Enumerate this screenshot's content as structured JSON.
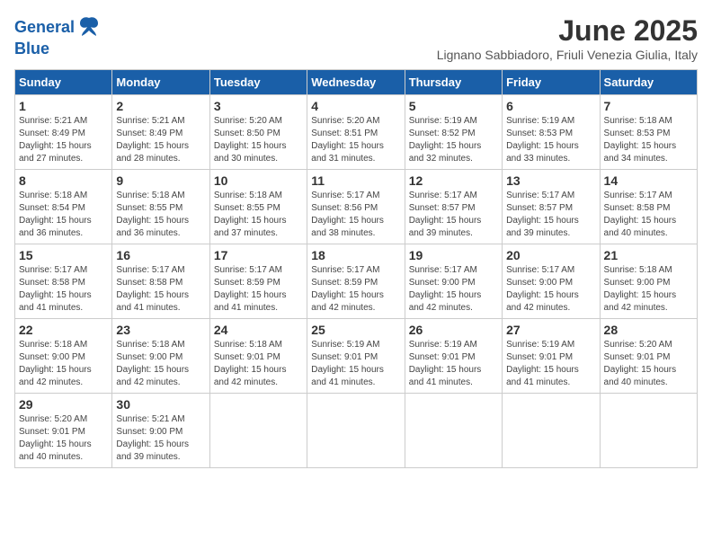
{
  "logo": {
    "line1": "General",
    "line2": "Blue"
  },
  "title": "June 2025",
  "location": "Lignano Sabbiadoro, Friuli Venezia Giulia, Italy",
  "weekdays": [
    "Sunday",
    "Monday",
    "Tuesday",
    "Wednesday",
    "Thursday",
    "Friday",
    "Saturday"
  ],
  "weeks": [
    [
      {
        "day": "1",
        "info": "Sunrise: 5:21 AM\nSunset: 8:49 PM\nDaylight: 15 hours\nand 27 minutes."
      },
      {
        "day": "2",
        "info": "Sunrise: 5:21 AM\nSunset: 8:49 PM\nDaylight: 15 hours\nand 28 minutes."
      },
      {
        "day": "3",
        "info": "Sunrise: 5:20 AM\nSunset: 8:50 PM\nDaylight: 15 hours\nand 30 minutes."
      },
      {
        "day": "4",
        "info": "Sunrise: 5:20 AM\nSunset: 8:51 PM\nDaylight: 15 hours\nand 31 minutes."
      },
      {
        "day": "5",
        "info": "Sunrise: 5:19 AM\nSunset: 8:52 PM\nDaylight: 15 hours\nand 32 minutes."
      },
      {
        "day": "6",
        "info": "Sunrise: 5:19 AM\nSunset: 8:53 PM\nDaylight: 15 hours\nand 33 minutes."
      },
      {
        "day": "7",
        "info": "Sunrise: 5:18 AM\nSunset: 8:53 PM\nDaylight: 15 hours\nand 34 minutes."
      }
    ],
    [
      {
        "day": "8",
        "info": "Sunrise: 5:18 AM\nSunset: 8:54 PM\nDaylight: 15 hours\nand 36 minutes."
      },
      {
        "day": "9",
        "info": "Sunrise: 5:18 AM\nSunset: 8:55 PM\nDaylight: 15 hours\nand 36 minutes."
      },
      {
        "day": "10",
        "info": "Sunrise: 5:18 AM\nSunset: 8:55 PM\nDaylight: 15 hours\nand 37 minutes."
      },
      {
        "day": "11",
        "info": "Sunrise: 5:17 AM\nSunset: 8:56 PM\nDaylight: 15 hours\nand 38 minutes."
      },
      {
        "day": "12",
        "info": "Sunrise: 5:17 AM\nSunset: 8:57 PM\nDaylight: 15 hours\nand 39 minutes."
      },
      {
        "day": "13",
        "info": "Sunrise: 5:17 AM\nSunset: 8:57 PM\nDaylight: 15 hours\nand 39 minutes."
      },
      {
        "day": "14",
        "info": "Sunrise: 5:17 AM\nSunset: 8:58 PM\nDaylight: 15 hours\nand 40 minutes."
      }
    ],
    [
      {
        "day": "15",
        "info": "Sunrise: 5:17 AM\nSunset: 8:58 PM\nDaylight: 15 hours\nand 41 minutes."
      },
      {
        "day": "16",
        "info": "Sunrise: 5:17 AM\nSunset: 8:58 PM\nDaylight: 15 hours\nand 41 minutes."
      },
      {
        "day": "17",
        "info": "Sunrise: 5:17 AM\nSunset: 8:59 PM\nDaylight: 15 hours\nand 41 minutes."
      },
      {
        "day": "18",
        "info": "Sunrise: 5:17 AM\nSunset: 8:59 PM\nDaylight: 15 hours\nand 42 minutes."
      },
      {
        "day": "19",
        "info": "Sunrise: 5:17 AM\nSunset: 9:00 PM\nDaylight: 15 hours\nand 42 minutes."
      },
      {
        "day": "20",
        "info": "Sunrise: 5:17 AM\nSunset: 9:00 PM\nDaylight: 15 hours\nand 42 minutes."
      },
      {
        "day": "21",
        "info": "Sunrise: 5:18 AM\nSunset: 9:00 PM\nDaylight: 15 hours\nand 42 minutes."
      }
    ],
    [
      {
        "day": "22",
        "info": "Sunrise: 5:18 AM\nSunset: 9:00 PM\nDaylight: 15 hours\nand 42 minutes."
      },
      {
        "day": "23",
        "info": "Sunrise: 5:18 AM\nSunset: 9:00 PM\nDaylight: 15 hours\nand 42 minutes."
      },
      {
        "day": "24",
        "info": "Sunrise: 5:18 AM\nSunset: 9:01 PM\nDaylight: 15 hours\nand 42 minutes."
      },
      {
        "day": "25",
        "info": "Sunrise: 5:19 AM\nSunset: 9:01 PM\nDaylight: 15 hours\nand 41 minutes."
      },
      {
        "day": "26",
        "info": "Sunrise: 5:19 AM\nSunset: 9:01 PM\nDaylight: 15 hours\nand 41 minutes."
      },
      {
        "day": "27",
        "info": "Sunrise: 5:19 AM\nSunset: 9:01 PM\nDaylight: 15 hours\nand 41 minutes."
      },
      {
        "day": "28",
        "info": "Sunrise: 5:20 AM\nSunset: 9:01 PM\nDaylight: 15 hours\nand 40 minutes."
      }
    ],
    [
      {
        "day": "29",
        "info": "Sunrise: 5:20 AM\nSunset: 9:01 PM\nDaylight: 15 hours\nand 40 minutes."
      },
      {
        "day": "30",
        "info": "Sunrise: 5:21 AM\nSunset: 9:00 PM\nDaylight: 15 hours\nand 39 minutes."
      },
      {
        "day": "",
        "info": ""
      },
      {
        "day": "",
        "info": ""
      },
      {
        "day": "",
        "info": ""
      },
      {
        "day": "",
        "info": ""
      },
      {
        "day": "",
        "info": ""
      }
    ]
  ]
}
